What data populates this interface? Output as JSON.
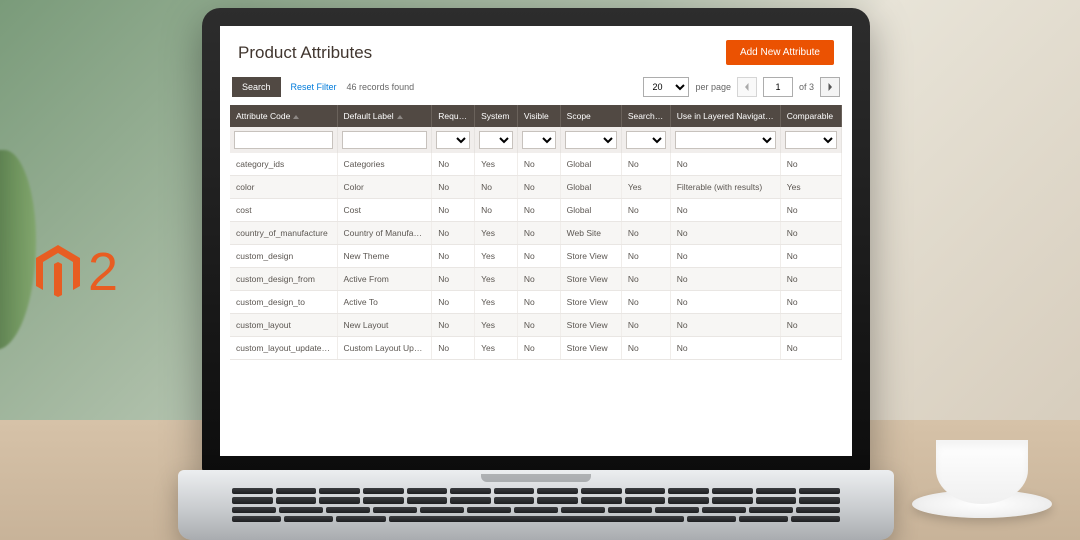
{
  "logo": {
    "text_2": "2"
  },
  "header": {
    "title": "Product Attributes",
    "add_button": "Add New Attribute"
  },
  "toolbar": {
    "search_label": "Search",
    "reset_label": "Reset Filter",
    "records_found": "46 records found",
    "per_page_value": "20",
    "per_page_label": "per page",
    "page_value": "1",
    "page_of": "of 3"
  },
  "columns": [
    "Attribute Code",
    "Default Label",
    "Required",
    "System",
    "Visible",
    "Scope",
    "Searchable",
    "Use in Layered Navigation",
    "Comparable"
  ],
  "rows": [
    {
      "code": "category_ids",
      "label": "Categories",
      "required": "No",
      "system": "Yes",
      "visible": "No",
      "scope": "Global",
      "searchable": "No",
      "layered": "No",
      "comparable": "No"
    },
    {
      "code": "color",
      "label": "Color",
      "required": "No",
      "system": "No",
      "visible": "No",
      "scope": "Global",
      "searchable": "Yes",
      "layered": "Filterable (with results)",
      "comparable": "Yes"
    },
    {
      "code": "cost",
      "label": "Cost",
      "required": "No",
      "system": "No",
      "visible": "No",
      "scope": "Global",
      "searchable": "No",
      "layered": "No",
      "comparable": "No"
    },
    {
      "code": "country_of_manufacture",
      "label": "Country of Manufacture",
      "required": "No",
      "system": "Yes",
      "visible": "No",
      "scope": "Web Site",
      "searchable": "No",
      "layered": "No",
      "comparable": "No"
    },
    {
      "code": "custom_design",
      "label": "New Theme",
      "required": "No",
      "system": "Yes",
      "visible": "No",
      "scope": "Store View",
      "searchable": "No",
      "layered": "No",
      "comparable": "No"
    },
    {
      "code": "custom_design_from",
      "label": "Active From",
      "required": "No",
      "system": "Yes",
      "visible": "No",
      "scope": "Store View",
      "searchable": "No",
      "layered": "No",
      "comparable": "No"
    },
    {
      "code": "custom_design_to",
      "label": "Active To",
      "required": "No",
      "system": "Yes",
      "visible": "No",
      "scope": "Store View",
      "searchable": "No",
      "layered": "No",
      "comparable": "No"
    },
    {
      "code": "custom_layout",
      "label": "New Layout",
      "required": "No",
      "system": "Yes",
      "visible": "No",
      "scope": "Store View",
      "searchable": "No",
      "layered": "No",
      "comparable": "No"
    },
    {
      "code": "custom_layout_update_file",
      "label": "Custom Layout Update",
      "required": "No",
      "system": "Yes",
      "visible": "No",
      "scope": "Store View",
      "searchable": "No",
      "layered": "No",
      "comparable": "No"
    }
  ]
}
